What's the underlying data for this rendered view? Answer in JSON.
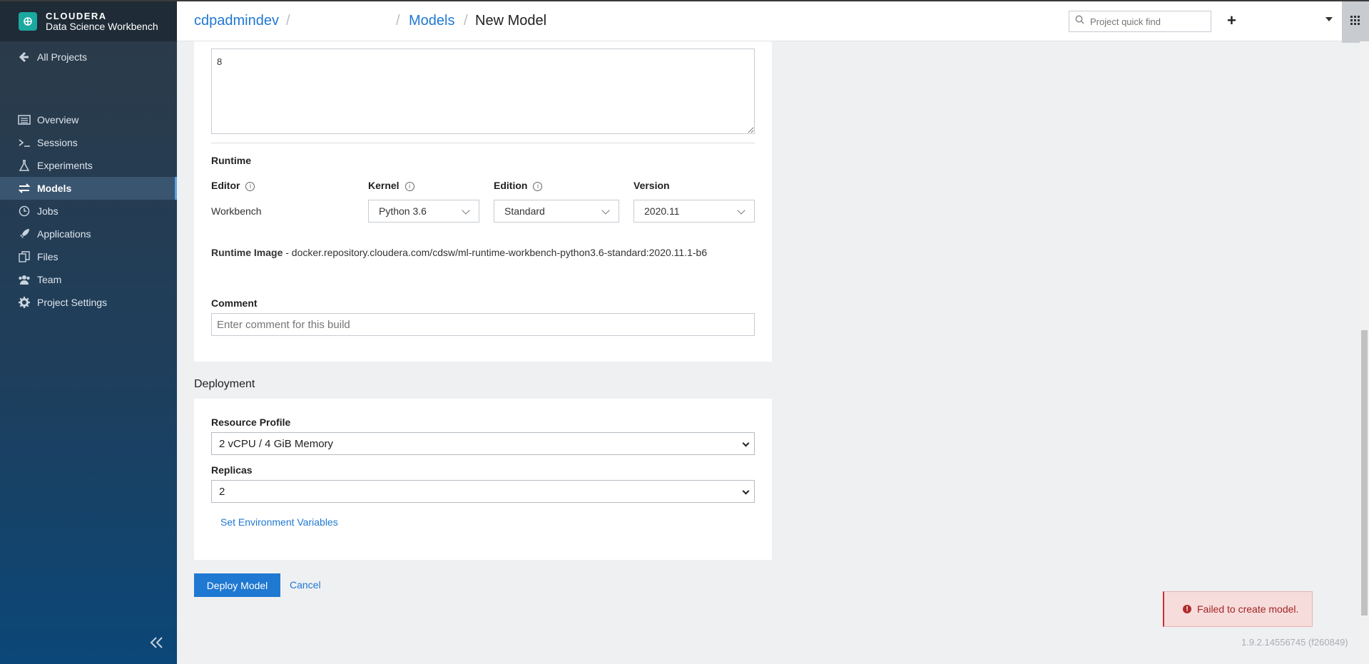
{
  "sidebar": {
    "brand_name": "CLOUDERA",
    "brand_sub": "Data Science Workbench",
    "all_projects": "All Projects",
    "items": [
      {
        "label": "Overview",
        "icon": "list-icon"
      },
      {
        "label": "Sessions",
        "icon": "terminal-icon"
      },
      {
        "label": "Experiments",
        "icon": "flask-icon"
      },
      {
        "label": "Models",
        "icon": "arrows-icon",
        "active": true
      },
      {
        "label": "Jobs",
        "icon": "clock-icon"
      },
      {
        "label": "Applications",
        "icon": "rocket-icon"
      },
      {
        "label": "Files",
        "icon": "files-icon"
      },
      {
        "label": "Team",
        "icon": "team-icon"
      },
      {
        "label": "Project Settings",
        "icon": "gear-icon"
      }
    ]
  },
  "header": {
    "crumb_project": "cdpadmindev",
    "crumb_sep": "/",
    "crumb_models": "Models",
    "crumb_current": "New Model",
    "quickfind_placeholder": "Project quick find",
    "plus": "+"
  },
  "form": {
    "example_output_value": "8",
    "runtime_heading": "Runtime",
    "editor_label": "Editor",
    "editor_value": "Workbench",
    "kernel_label": "Kernel",
    "kernel_value": "Python 3.6",
    "edition_label": "Edition",
    "edition_value": "Standard",
    "version_label": "Version",
    "version_value": "2020.11",
    "runtime_image_label": "Runtime Image",
    "runtime_image_value": " - docker.repository.cloudera.com/cdsw/ml-runtime-workbench-python3.6-standard:2020.11.1-b6",
    "comment_label": "Comment",
    "comment_placeholder": "Enter comment for this build"
  },
  "deployment": {
    "heading": "Deployment",
    "resource_label": "Resource Profile",
    "resource_value": "2 vCPU / 4 GiB Memory",
    "replicas_label": "Replicas",
    "replicas_value": "2",
    "env_link": "Set Environment Variables"
  },
  "actions": {
    "deploy": "Deploy Model",
    "cancel": "Cancel"
  },
  "toast": {
    "message": "Failed to create model."
  },
  "footer": {
    "version": "1.9.2.14556745 (f260849)"
  },
  "colors": {
    "accent": "#1f78d1",
    "error_bg": "#f7dcdc",
    "error_text": "#a32424"
  }
}
